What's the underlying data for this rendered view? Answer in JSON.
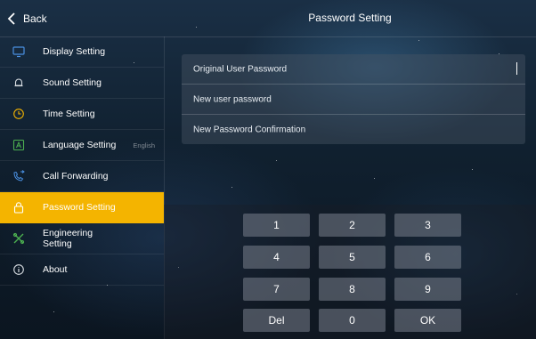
{
  "header": {
    "back_label": "Back",
    "title": "Password Setting"
  },
  "sidebar": {
    "items": [
      {
        "label": "Display Setting",
        "icon": "monitor-icon"
      },
      {
        "label": "Sound Setting",
        "icon": "bell-icon"
      },
      {
        "label": "Time Setting",
        "icon": "clock-icon"
      },
      {
        "label": "Language Setting",
        "icon": "language-icon",
        "extra": "English"
      },
      {
        "label": "Call Forwarding",
        "icon": "call-forward-icon"
      },
      {
        "label": "Password Setting",
        "icon": "lock-icon",
        "active": true
      },
      {
        "label": "Engineering Setting",
        "icon": "tools-icon"
      },
      {
        "label": "About",
        "icon": "info-icon"
      }
    ]
  },
  "password_form": {
    "original_placeholder": "Original User Password",
    "new_placeholder": "New user password",
    "confirm_placeholder": "New Password Confirmation"
  },
  "keypad": {
    "keys": [
      "1",
      "2",
      "3",
      "4",
      "5",
      "6",
      "7",
      "8",
      "9",
      "Del",
      "0",
      "OK"
    ]
  },
  "colors": {
    "accent": "#f4b400",
    "icon_green": "#4caf50",
    "key_bg": "#78808c"
  }
}
